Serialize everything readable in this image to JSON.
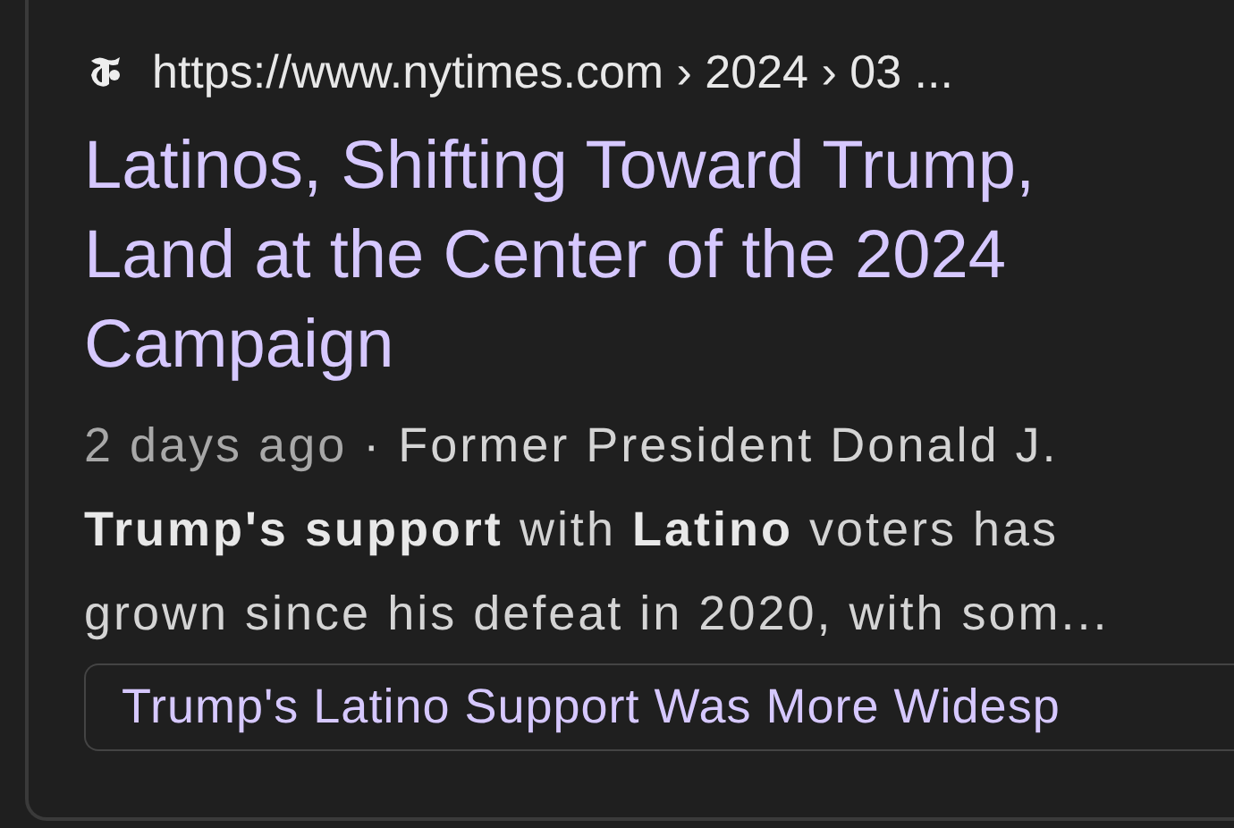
{
  "result": {
    "source_url": "https://www.nytimes.com › 2024 › 03 ...",
    "title": "Latinos, Shifting Toward Trump, Land at the Center of the 2024 Campaign",
    "date": "2 days ago",
    "snippet": "· Former President Donald J. **Trump's support** with **Latino** voters has grown since his defeat in 2020, with som...",
    "related_links": [
      "Trump's Latino Support Was More Widesp"
    ]
  }
}
